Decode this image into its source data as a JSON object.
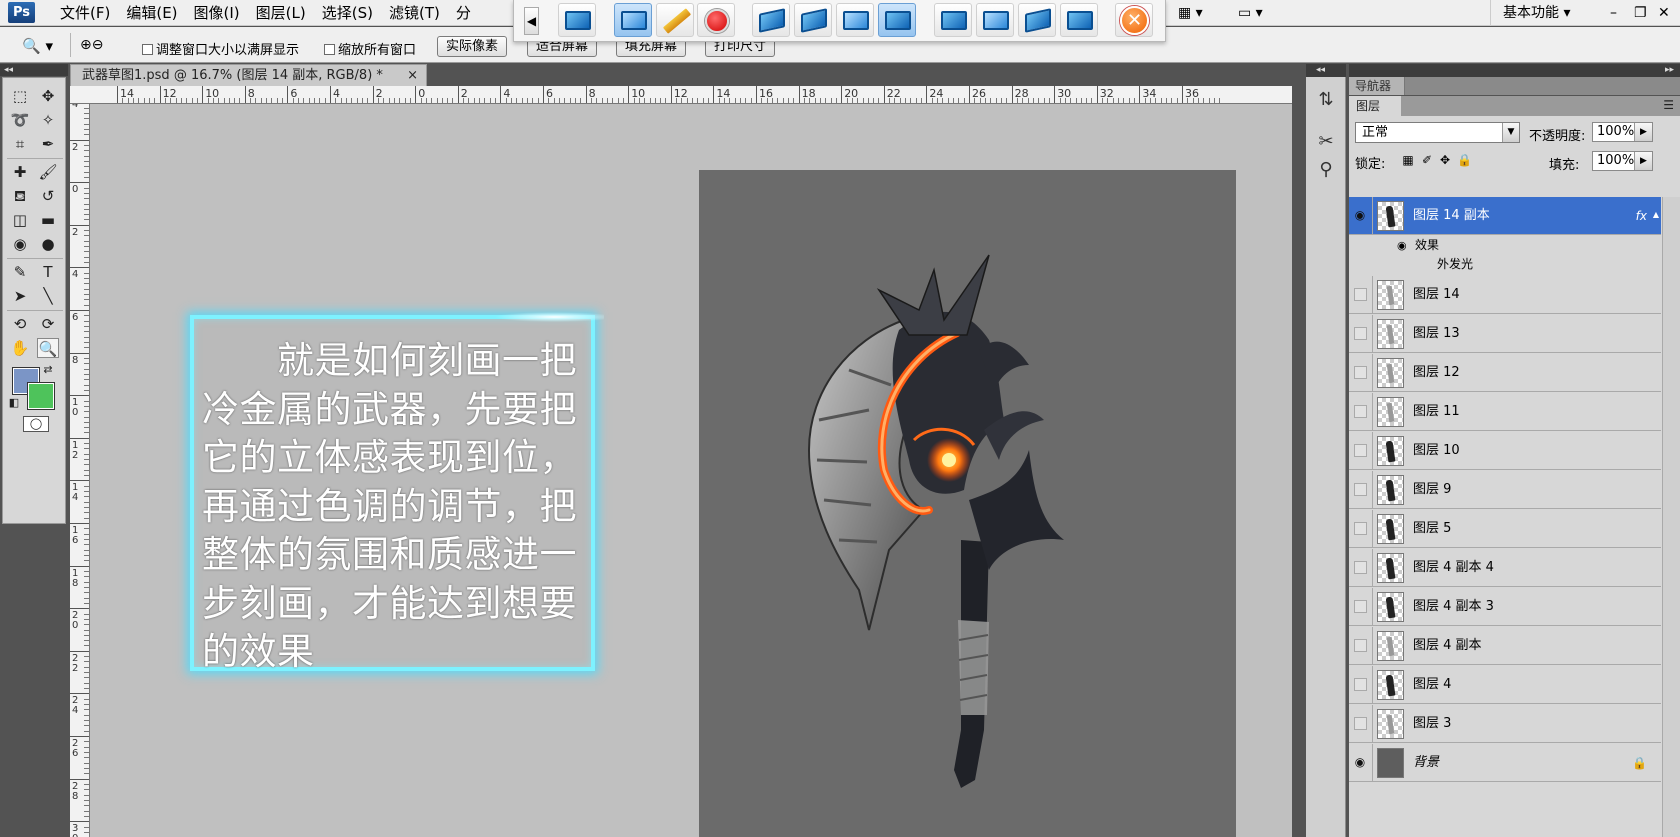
{
  "menubar": {
    "logo": "Ps",
    "items": [
      "文件(F)",
      "编辑(E)",
      "图像(I)",
      "图层(L)",
      "选择(S)",
      "滤镜(T)",
      "分"
    ],
    "workspace": "基本功能",
    "window_controls": [
      "–",
      "❐",
      "✕"
    ]
  },
  "recorder_toolbar": {
    "arrow": "◀",
    "close_glyph": "✕"
  },
  "options_bar": {
    "zoom_glyph": "🔍",
    "checkbox_resize": "调整窗口大小以满屏显示",
    "checkbox_zoom_all": "缩放所有窗口",
    "btn_actual": "实际像素",
    "btn_fit": "适合屏幕",
    "btn_fill": "填充屏幕",
    "btn_print": "打印尺寸"
  },
  "document": {
    "tab_title": "武器草图1.psd @ 16.7% (图层 14 副本, RGB/8) *",
    "tab_close": "×",
    "ruler_top_labels": [
      "14",
      "12",
      "10",
      "8",
      "6",
      "4",
      "2",
      "0",
      "2",
      "4",
      "6",
      "8",
      "10",
      "12",
      "14",
      "16",
      "18",
      "20",
      "22",
      "24",
      "26",
      "28",
      "30",
      "32",
      "34",
      "36"
    ],
    "ruler_left_labels": [
      "4",
      "2",
      "0",
      "2",
      "4",
      "6",
      "8",
      "10",
      "12",
      "14",
      "16",
      "18",
      "20",
      "22",
      "24",
      "26",
      "28",
      "30"
    ],
    "callout_text": "　　就是如何刻画一把冷金属的武器，先要把它的立体感表现到位，再通过色调的调节，把整体的氛围和质感进一步刻画，才能达到想要的效果"
  },
  "panels": {
    "navigator_tab": "导航器",
    "layers_tab": "图层",
    "blend_mode": "正常",
    "opacity_label": "不透明度:",
    "opacity_value": "100%",
    "lock_label": "锁定:",
    "fill_label": "填充:",
    "fill_value": "100%",
    "effects_label": "效果",
    "outer_glow_label": "外发光",
    "layers": [
      {
        "name": "图层 14 副本",
        "visible": true,
        "selected": true,
        "fx": "fx"
      },
      {
        "name": "图层 14",
        "visible": false
      },
      {
        "name": "图层 13",
        "visible": false
      },
      {
        "name": "图层 12",
        "visible": false
      },
      {
        "name": "图层 11",
        "visible": false
      },
      {
        "name": "图层 10",
        "visible": false
      },
      {
        "name": "图层 9",
        "visible": false
      },
      {
        "name": "图层 5",
        "visible": false
      },
      {
        "name": "图层 4 副本 4",
        "visible": false
      },
      {
        "name": "图层 4 副本 3",
        "visible": false
      },
      {
        "name": "图层 4 副本",
        "visible": false
      },
      {
        "name": "图层 4",
        "visible": false
      },
      {
        "name": "图层 3",
        "visible": false
      },
      {
        "name": "背景",
        "visible": true,
        "locked": true
      }
    ]
  },
  "colors": {
    "foreground": "#7b95c6",
    "background": "#4ec35b",
    "callout_border": "#7ef2ff",
    "selection": "#3a6fcc"
  }
}
